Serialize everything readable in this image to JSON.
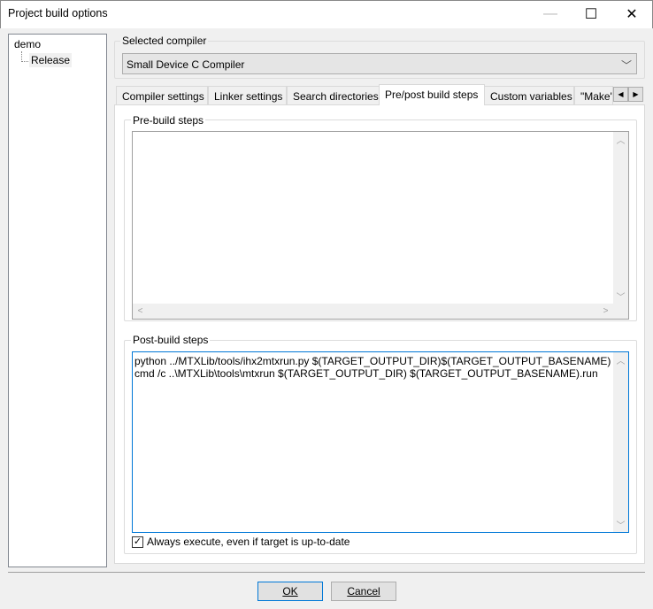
{
  "window": {
    "title": "Project build options",
    "minimize_icon": "minimize-icon",
    "maximize_icon": "maximize-icon",
    "close_icon": "close-icon"
  },
  "tree": {
    "root": "demo",
    "children": [
      "Release"
    ]
  },
  "compiler": {
    "group_label": "Selected compiler",
    "selected": "Small Device C Compiler"
  },
  "tabs": [
    {
      "label": "Compiler settings"
    },
    {
      "label": "Linker settings"
    },
    {
      "label": "Search directories"
    },
    {
      "label": "Pre/post build steps",
      "active": true
    },
    {
      "label": "Custom variables"
    },
    {
      "label": "\"Make\""
    }
  ],
  "pre_build": {
    "label": "Pre-build steps",
    "lines": []
  },
  "post_build": {
    "label": "Post-build steps",
    "lines": [
      "python ../MTXLib/tools/ihx2mtxrun.py $(TARGET_OUTPUT_DIR)$(TARGET_OUTPUT_BASENAME)",
      "cmd /c ..\\MTXLib\\tools\\mtxrun $(TARGET_OUTPUT_DIR) $(TARGET_OUTPUT_BASENAME).run"
    ]
  },
  "always_execute": {
    "label": "Always execute, even if target is up-to-date",
    "checked": true
  },
  "buttons": {
    "ok": "OK",
    "cancel": "Cancel"
  }
}
